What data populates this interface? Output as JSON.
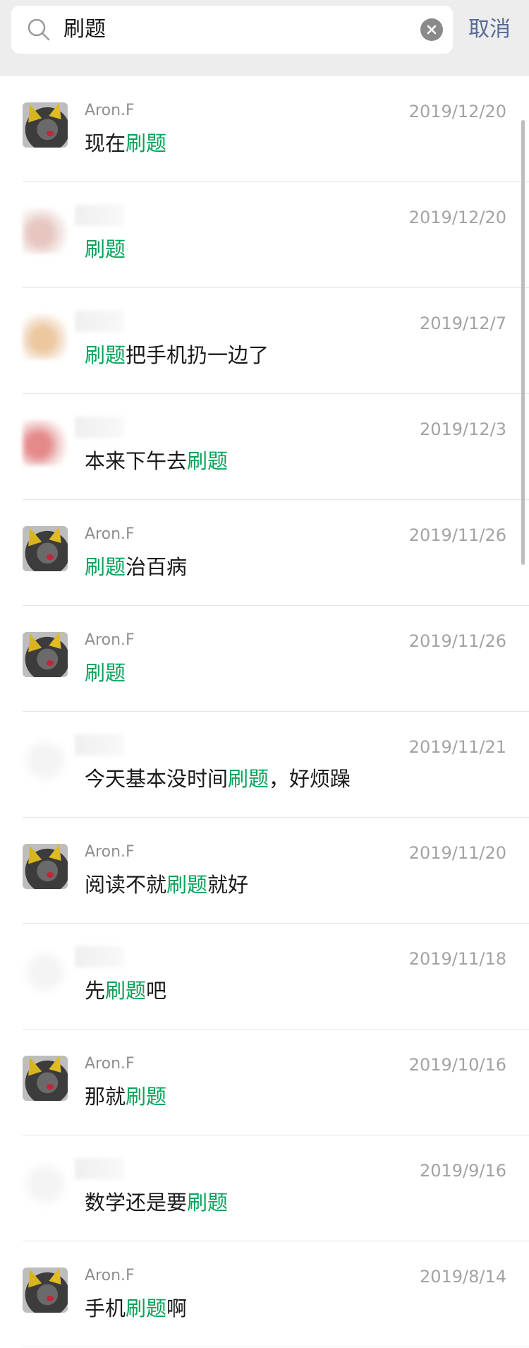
{
  "search": {
    "query": "刷题",
    "cancel_label": "取消"
  },
  "colors": {
    "highlight": "#07a35a",
    "link_blue": "#576b95",
    "header_bg": "#ededed"
  },
  "results": [
    {
      "nickname": "Aron.F",
      "date": "2019/12/20",
      "pre": "现在",
      "hit": "刷题",
      "post": "",
      "avatar": "cat"
    },
    {
      "nickname": "",
      "date": "2019/12/20",
      "pre": "",
      "hit": "刷题",
      "post": "",
      "avatar": "blur1"
    },
    {
      "nickname": "",
      "date": "2019/12/7",
      "pre": "",
      "hit": "刷题",
      "post": "把手机扔一边了",
      "avatar": "blur2"
    },
    {
      "nickname": "",
      "date": "2019/12/3",
      "pre": "本来下午去",
      "hit": "刷题",
      "post": "",
      "avatar": "blur3"
    },
    {
      "nickname": "Aron.F",
      "date": "2019/11/26",
      "pre": "",
      "hit": "刷题",
      "post": "治百病",
      "avatar": "cat"
    },
    {
      "nickname": "Aron.F",
      "date": "2019/11/26",
      "pre": "",
      "hit": "刷题",
      "post": "",
      "avatar": "cat"
    },
    {
      "nickname": "",
      "date": "2019/11/21",
      "pre": "今天基本没时间",
      "hit": "刷题",
      "post": "，好烦躁",
      "avatar": "blur4"
    },
    {
      "nickname": "Aron.F",
      "date": "2019/11/20",
      "pre": "阅读不就",
      "hit": "刷题",
      "post": "就好",
      "avatar": "cat"
    },
    {
      "nickname": "",
      "date": "2019/11/18",
      "pre": "先",
      "hit": "刷题",
      "post": "吧",
      "avatar": "blur4"
    },
    {
      "nickname": "Aron.F",
      "date": "2019/10/16",
      "pre": "那就",
      "hit": "刷题",
      "post": "",
      "avatar": "cat"
    },
    {
      "nickname": "",
      "date": "2019/9/16",
      "pre": "数学还是要",
      "hit": "刷题",
      "post": "",
      "avatar": "blur4"
    },
    {
      "nickname": "Aron.F",
      "date": "2019/8/14",
      "pre": "手机",
      "hit": "刷题",
      "post": "啊",
      "avatar": "cat"
    }
  ]
}
